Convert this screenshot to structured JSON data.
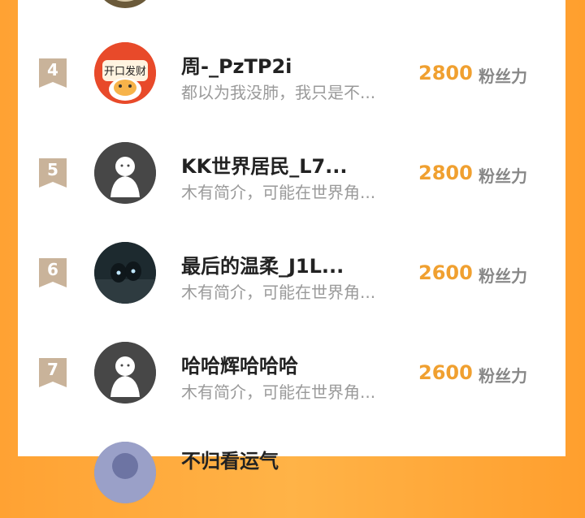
{
  "list": {
    "rows": [
      {
        "rank": "4",
        "name": "周-_PzTP2i",
        "bio": "都以为我没肺，我只是不...",
        "score": "2800",
        "unit": "粉丝力",
        "avatar": "tiger-sticker-avatar"
      },
      {
        "rank": "5",
        "name": "KK世界居民_L7...",
        "bio": "木有简介，可能在世界角...",
        "score": "2800",
        "unit": "粉丝力",
        "avatar": "default-avatar"
      },
      {
        "rank": "6",
        "name": "最后的温柔_J1L...",
        "bio": "木有简介，可能在世界角...",
        "score": "2600",
        "unit": "粉丝力",
        "avatar": "night-photo-avatar"
      },
      {
        "rank": "7",
        "name": "哈哈辉哈哈哈",
        "bio": "木有简介，可能在世界角...",
        "score": "2600",
        "unit": "粉丝力",
        "avatar": "default-avatar"
      },
      {
        "rank": "",
        "name": "不归看运气",
        "bio": "",
        "score": "",
        "unit": "",
        "avatar": "partial-avatar"
      }
    ]
  },
  "colors": {
    "accent": "#f0a030",
    "background": "#ffa233",
    "rank_badge": "#c9b39a"
  }
}
